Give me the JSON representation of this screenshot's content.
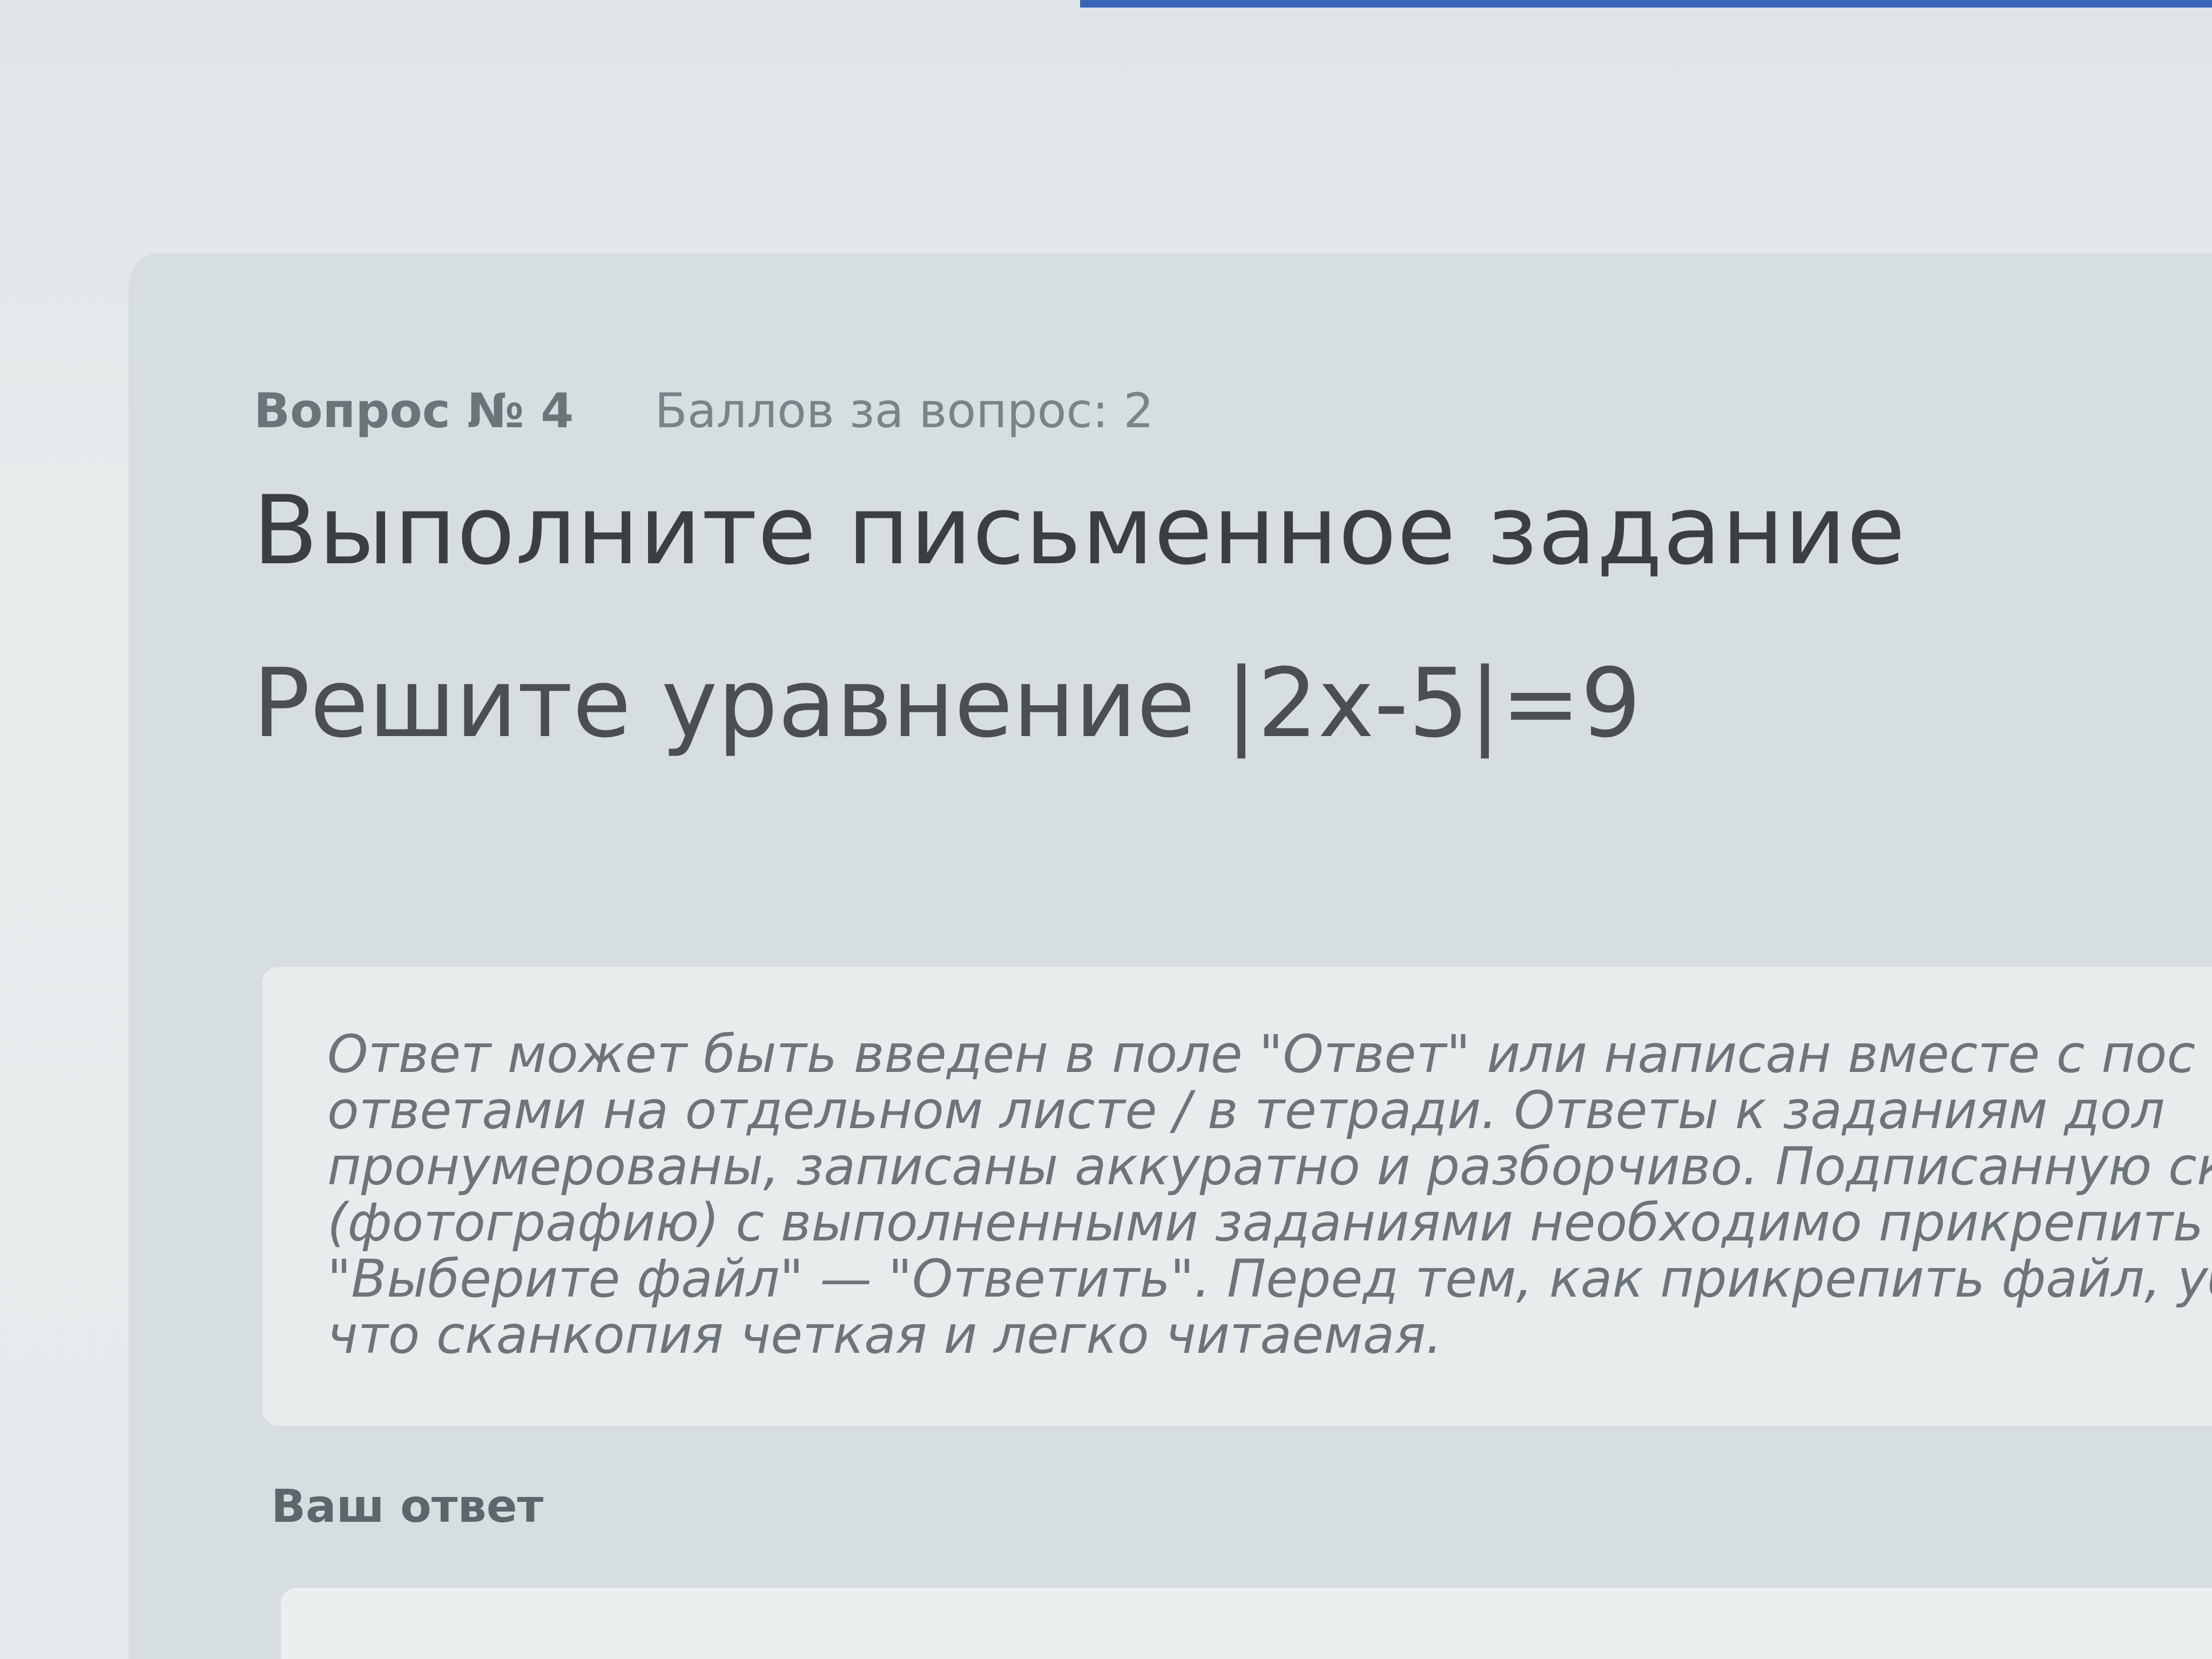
{
  "question": {
    "number_label": "Вопрос № 4",
    "points_label": "Баллов за вопрос: 2",
    "title": "Выполните письменное задание",
    "text": "Решите уравнение |2x-5|=9"
  },
  "instructions": {
    "lines": [
      "Ответ может быть введен в поле \"Ответ\" или написан вместе с пос",
      "ответами на отдельном листе / в тетради. Ответы к заданиям дол",
      "пронумерованы, записаны аккуратно и разборчиво. Подписанную скан",
      "(фотографию) с выполненными заданиями необходимо прикрепить чер",
      "\"Выберите файл\" — \"Ответить\". Перед тем, как прикрепить файл, убе",
      "что сканкопия четкая и легко читаемая."
    ]
  },
  "answer": {
    "label": "Ваш ответ",
    "value": ""
  },
  "colors": {
    "card_bg": "#d6dedf",
    "instruction_bg": "#e9ecec",
    "top_bar": "#3a64b8"
  }
}
